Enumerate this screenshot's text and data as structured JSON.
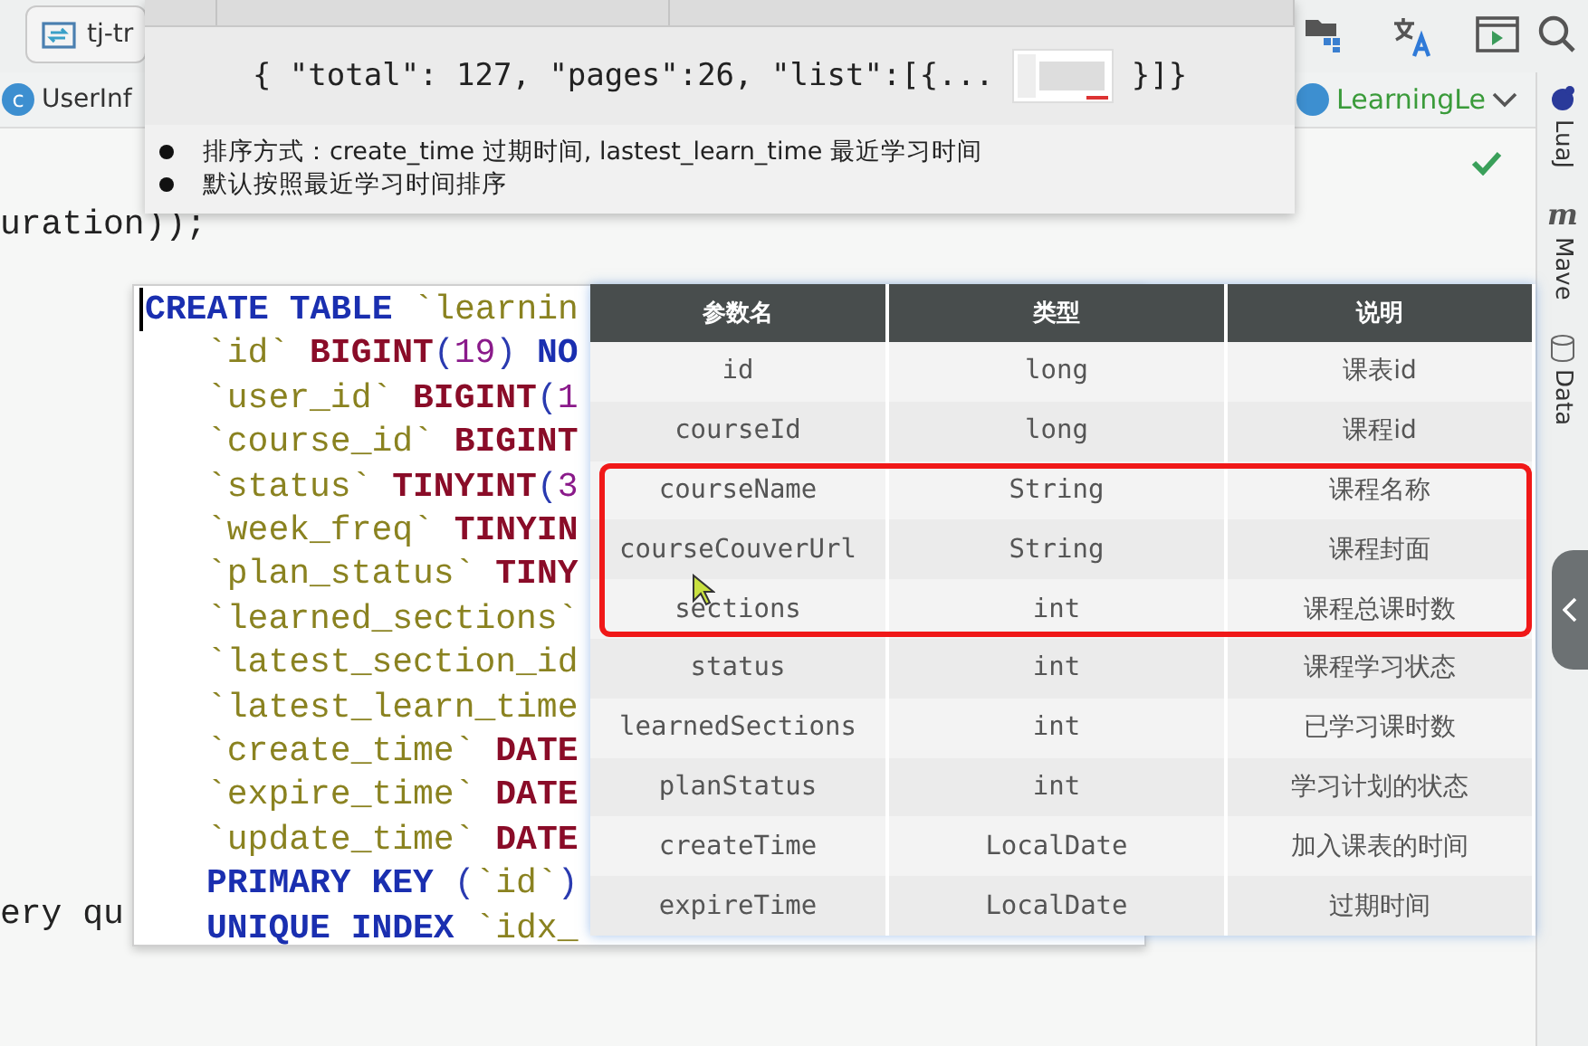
{
  "toolbar": {
    "project_tab": "tj-tr"
  },
  "editor_tabs": {
    "left": "UserInf",
    "left_icon": "c",
    "right": "LearningLe"
  },
  "side_panel": [
    {
      "kind": "plugin",
      "label": "LuaJ"
    },
    {
      "kind": "maven",
      "label": "Mave",
      "icon_text": "m"
    },
    {
      "kind": "database",
      "label": "Data"
    }
  ],
  "editor": {
    "lines": [
      "uration));",
      "ery qu"
    ]
  },
  "api_doc_popup": {
    "response_example": [
      "{ \"total\": 127, \"pages\":26, \"list\":[{...",
      "}]}"
    ],
    "notes": [
      "排序方式：create_time 过期时间, lastest_learn_time 最近学习时间",
      "默认按照最近学习时间排序"
    ]
  },
  "sql_popup": {
    "lines": [
      {
        "kind": "head",
        "tokens": [
          {
            "kind": "kw",
            "t": "CREATE TABLE"
          },
          {
            "kind": "ident",
            "t": " `learnin"
          }
        ]
      },
      {
        "kind": "body",
        "tokens": [
          {
            "kind": "ident",
            "t": "`id`"
          },
          {
            "kind": "type",
            "t": " BIGINT"
          },
          {
            "kind": "punct",
            "t": "("
          },
          {
            "kind": "num",
            "t": "19"
          },
          {
            "kind": "punct",
            "t": ")"
          },
          {
            "kind": "kw",
            "t": " NO"
          }
        ]
      },
      {
        "kind": "body",
        "tokens": [
          {
            "kind": "ident",
            "t": "`user_id`"
          },
          {
            "kind": "type",
            "t": " BIGINT"
          },
          {
            "kind": "punct",
            "t": "("
          },
          {
            "kind": "num",
            "t": "1"
          }
        ]
      },
      {
        "kind": "body",
        "tokens": [
          {
            "kind": "ident",
            "t": "`course_id`"
          },
          {
            "kind": "type",
            "t": " BIGINT"
          }
        ]
      },
      {
        "kind": "body",
        "tokens": [
          {
            "kind": "ident",
            "t": "`status`"
          },
          {
            "kind": "type",
            "t": " TINYINT"
          },
          {
            "kind": "punct",
            "t": "("
          },
          {
            "kind": "num",
            "t": "3"
          }
        ]
      },
      {
        "kind": "body",
        "tokens": [
          {
            "kind": "ident",
            "t": "`week_freq`"
          },
          {
            "kind": "type",
            "t": " TINYIN"
          }
        ]
      },
      {
        "kind": "body",
        "tokens": [
          {
            "kind": "ident",
            "t": "`plan_status`"
          },
          {
            "kind": "type",
            "t": " TINY"
          }
        ]
      },
      {
        "kind": "body",
        "tokens": [
          {
            "kind": "ident",
            "t": "`learned_sections`"
          }
        ]
      },
      {
        "kind": "body",
        "tokens": [
          {
            "kind": "ident",
            "t": "`latest_section_id"
          }
        ]
      },
      {
        "kind": "body",
        "tokens": [
          {
            "kind": "ident",
            "t": "`latest_learn_time"
          }
        ]
      },
      {
        "kind": "body",
        "tokens": [
          {
            "kind": "ident",
            "t": "`create_time`"
          },
          {
            "kind": "type",
            "t": " DATE"
          }
        ]
      },
      {
        "kind": "body",
        "tokens": [
          {
            "kind": "ident",
            "t": "`expire_time`"
          },
          {
            "kind": "type",
            "t": " DATE"
          }
        ]
      },
      {
        "kind": "body",
        "tokens": [
          {
            "kind": "ident",
            "t": "`update_time`"
          },
          {
            "kind": "type",
            "t": " DATE"
          }
        ]
      },
      {
        "kind": "body",
        "tokens": [
          {
            "kind": "kw",
            "t": "PRIMARY KEY"
          },
          {
            "kind": "punct",
            "t": " ("
          },
          {
            "kind": "ident",
            "t": "`id`"
          },
          {
            "kind": "punct",
            "t": ")"
          }
        ]
      },
      {
        "kind": "body",
        "tokens": [
          {
            "kind": "kw",
            "t": "UNIQUE INDEX"
          },
          {
            "kind": "ident",
            "t": " `idx_"
          }
        ]
      }
    ]
  },
  "param_table": {
    "columns": [
      "参数名",
      "类型",
      "说明"
    ],
    "rows": [
      {
        "cells": [
          "id",
          "long",
          "课表id"
        ],
        "highlighted": false
      },
      {
        "cells": [
          "courseId",
          "long",
          "课程id"
        ],
        "highlighted": false
      },
      {
        "cells": [
          "courseName",
          "String",
          "课程名称"
        ],
        "highlighted": true
      },
      {
        "cells": [
          "courseCouverUrl",
          "String",
          "课程封面"
        ],
        "highlighted": true
      },
      {
        "cells": [
          "sections",
          "int",
          "课程总课时数"
        ],
        "highlighted": true
      },
      {
        "cells": [
          "status",
          "int",
          "课程学习状态"
        ],
        "highlighted": false
      },
      {
        "cells": [
          "learnedSections",
          "int",
          "已学习课时数"
        ],
        "highlighted": false
      },
      {
        "cells": [
          "planStatus",
          "int",
          "学习计划的状态"
        ],
        "highlighted": false
      },
      {
        "cells": [
          "createTime",
          "LocalDate",
          "加入课表的时间"
        ],
        "highlighted": false
      },
      {
        "cells": [
          "expireTime",
          "LocalDate",
          "过期时间"
        ],
        "highlighted": false
      }
    ]
  }
}
